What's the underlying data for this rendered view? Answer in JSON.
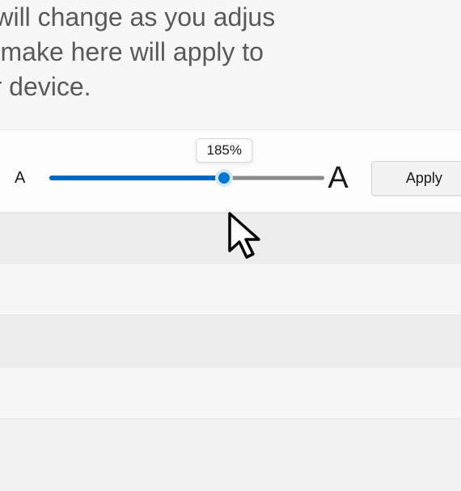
{
  "description": {
    "line1": "rds will change as you adjus",
    "line2": "you make here will apply to",
    "line3": "your device."
  },
  "slider": {
    "small_label": "A",
    "large_label": "A",
    "tooltip_value": "185%",
    "percent": 63.5
  },
  "apply_button_label": "Apply",
  "colors": {
    "accent": "#0078d4",
    "track_fill": "#0067c0"
  }
}
